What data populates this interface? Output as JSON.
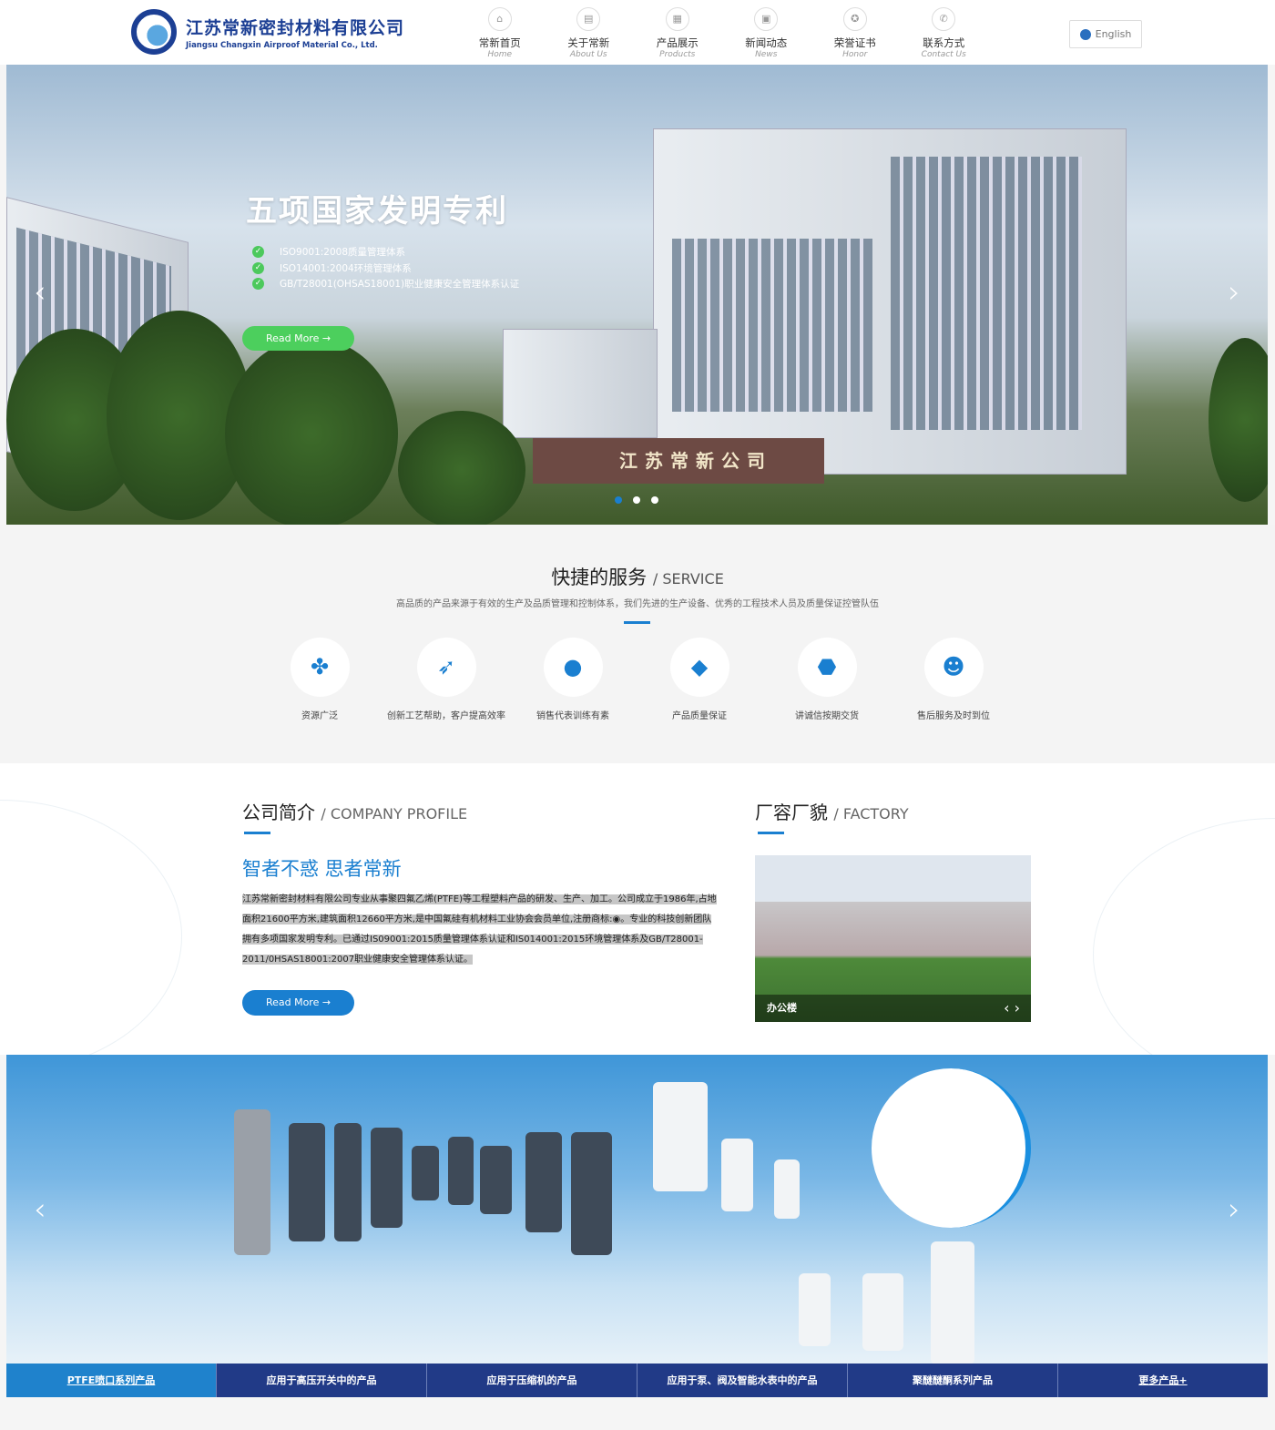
{
  "header": {
    "logo_cn": "江苏常新密封材料有限公司",
    "logo_en": "Jiangsu Changxin Airproof Material Co., Ltd.",
    "nav": [
      {
        "cn": "常新首页",
        "en": "Home",
        "icon": "home-icon"
      },
      {
        "cn": "关于常新",
        "en": "About Us",
        "icon": "document-icon"
      },
      {
        "cn": "产品展示",
        "en": "Products",
        "icon": "grid-icon"
      },
      {
        "cn": "新闻动态",
        "en": "News",
        "icon": "news-icon"
      },
      {
        "cn": "荣誉证书",
        "en": "Honor",
        "icon": "medal-icon"
      },
      {
        "cn": "联系方式",
        "en": "Contact Us",
        "icon": "phone-icon"
      }
    ],
    "language": "English"
  },
  "hero": {
    "title": "五项国家发明专利",
    "items": [
      "ISO9001:2008质量管理体系",
      "ISO14001:2004环境管理体系",
      "GB/T28001(OHSAS18001)职业健康安全管理体系认证"
    ],
    "button": "Read More",
    "sign_text": "江苏常新公司",
    "slides": 3,
    "active_slide": 1
  },
  "service": {
    "title": "快捷的服务",
    "title_en": "/ SERVICE",
    "subtitle": "高品质的产品来源于有效的生产及品质管理和控制体系，我们先进的生产设备、优秀的工程技术人员及质量保证控管队伍",
    "items": [
      {
        "label": "资源广泛",
        "icon": "clover-icon"
      },
      {
        "label": "创新工艺帮助，客户提高效率",
        "icon": "paper-plane-icon"
      },
      {
        "label": "销售代表训练有素",
        "icon": "user-icon"
      },
      {
        "label": "产品质量保证",
        "icon": "diamond-icon"
      },
      {
        "label": "讲诚信按期交货",
        "icon": "clock-icon"
      },
      {
        "label": "售后服务及时到位",
        "icon": "headset-icon"
      }
    ]
  },
  "profile": {
    "title": "公司简介",
    "title_en": "/ COMPANY PROFILE",
    "slogan": "智者不惑 思者常新",
    "text": "江苏常新密封材料有限公司专业从事聚四氟乙烯(PTFE)等工程塑料产品的研发、生产、加工。公司成立于1986年,占地面积21600平方米,建筑面积12660平方米,是中国氟硅有机材料工业协会会员单位,注册商标:◉。专业的科技创新团队拥有多项国家发明专利。已通过IS09001:2015质量管理体系认证和IS014001:2015环境管理体系及GB/T28001-2011/0HSAS18001:2007职业健康安全管理体系认证。",
    "button": "Read More"
  },
  "factory": {
    "title": "厂容厂貌",
    "title_en": "/ FACTORY",
    "caption": "办公楼"
  },
  "products": {
    "tabs": [
      "PTFE喷口系列产品",
      "应用于高压开关中的产品",
      "应用于压缩机的产品",
      "应用于泵、阀及智能水表中的产品",
      "聚醚醚酮系列产品",
      "更多产品+"
    ],
    "active_tab": 0
  },
  "colors": {
    "accent": "#1a7fd0",
    "green": "#4ccf5d",
    "navy": "#213a87",
    "logo": "#1c3f94"
  }
}
